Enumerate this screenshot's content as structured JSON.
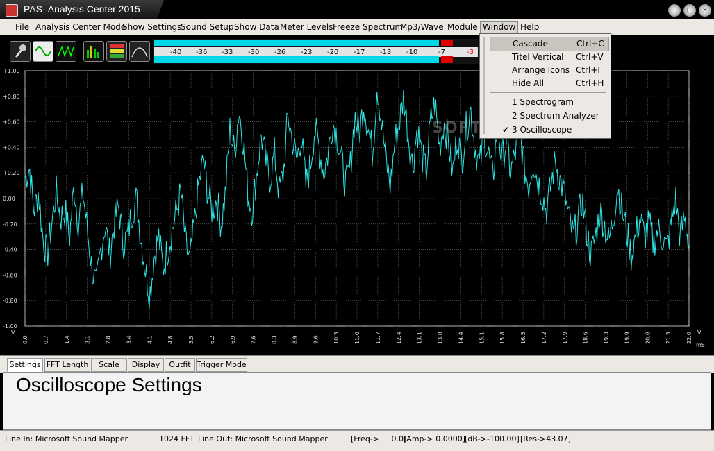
{
  "window": {
    "title": "PAS- Analysis Center 2015"
  },
  "menu": [
    "File",
    "Analysis Center Mode",
    "Show Settings",
    "Sound Setup",
    "Show Data",
    "Meter Levels",
    "Freeze Spectrum",
    "Mp3/Wave",
    "Module",
    "Window",
    "Help"
  ],
  "meter": {
    "scale": [
      "-40",
      "-36",
      "-33",
      "-30",
      "-26",
      "-23",
      "-20",
      "-17",
      "-13",
      "-10",
      "-7",
      "-3"
    ],
    "level_top": 0.88,
    "level_bottom": 0.88
  },
  "window_menu": {
    "items": [
      {
        "label": "Cascade",
        "shortcut": "Ctrl+C"
      },
      {
        "label": "Titel Vertical",
        "shortcut": "Ctrl+V"
      },
      {
        "label": "Arrange Icons",
        "shortcut": "Ctrl+I"
      },
      {
        "label": "Hide All",
        "shortcut": "Ctrl+H"
      }
    ],
    "windows": [
      "1 Spectrogram",
      "2 Spectrum Analyzer",
      "3 Oscilloscope"
    ]
  },
  "chart_data": {
    "type": "line",
    "ylim": [
      -1.0,
      1.0
    ],
    "y_ticks": [
      "+1.00",
      "+0.80",
      "+0.60",
      "+0.40",
      "+0.20",
      "0.00",
      "-0.20",
      "-0.40",
      "-0.60",
      "-0.80",
      "-1.00"
    ],
    "x_ticks": [
      "0.0",
      "0.7",
      "1.4",
      "2.1",
      "2.8",
      "3.4",
      "4.1",
      "4.8",
      "5.5",
      "6.2",
      "6.9",
      "7.6",
      "8.3",
      "8.9",
      "9.6",
      "10.3",
      "11.0",
      "11.7",
      "12.4",
      "13.1",
      "13.8",
      "14.4",
      "15.1",
      "15.8",
      "16.5",
      "17.2",
      "17.9",
      "18.6",
      "19.3",
      "19.9",
      "20.6",
      "21.3",
      "22.0"
    ],
    "y_unit": "V",
    "x_unit": "mS",
    "color": "#2ee6e6",
    "waveform": [
      0.15,
      0.25,
      -0.1,
      0.05,
      -0.3,
      -0.45,
      -0.2,
      0.05,
      -0.15,
      -0.1,
      -0.3,
      0.1,
      -0.2,
      0.05,
      -0.25,
      -0.55,
      -0.7,
      -0.4,
      -0.2,
      -0.45,
      -0.2,
      -0.05,
      -0.35,
      -0.3,
      -0.1,
      0.0,
      -0.3,
      -0.55,
      -0.75,
      -0.45,
      -0.3,
      -0.55,
      -0.4,
      -0.25,
      -0.1,
      0.05,
      -0.35,
      -0.5,
      -0.2,
      0.1,
      0.3,
      0.05,
      -0.1,
      0.0,
      -0.2,
      0.05,
      0.55,
      0.35,
      0.7,
      0.45,
      0.05,
      -0.1,
      0.2,
      0.5,
      0.3,
      0.15,
      0.35,
      0.05,
      0.2,
      0.65,
      0.45,
      0.3,
      0.5,
      0.1,
      0.25,
      0.55,
      0.4,
      0.2,
      0.35,
      0.6,
      0.5,
      0.3,
      0.1,
      0.25,
      0.65,
      0.5,
      0.75,
      0.55,
      0.35,
      0.9,
      0.6,
      0.3,
      0.1,
      0.45,
      0.6,
      0.8,
      0.5,
      0.25,
      0.55,
      0.35,
      0.2,
      0.6,
      0.75,
      0.4,
      0.6,
      0.45,
      0.2,
      0.5,
      0.3,
      0.55,
      0.7,
      0.4,
      0.25,
      0.5,
      0.35,
      0.15,
      0.6,
      0.3,
      0.45,
      0.2,
      0.35,
      0.55,
      0.25,
      0.1,
      0.3,
      0.15,
      0.05,
      -0.1,
      0.1,
      0.3,
      0.15,
      0.05,
      -0.15,
      -0.3,
      -0.2,
      0.0,
      -0.25,
      -0.45,
      -0.3,
      -0.1,
      -0.2,
      -0.35,
      -0.15,
      0.1,
      -0.1,
      -0.25,
      -0.45,
      -0.3,
      -0.15,
      -0.3,
      -0.2,
      -0.35,
      -0.25,
      -0.3,
      -0.4,
      -0.2,
      0.0,
      -0.3,
      -0.15,
      -0.35
    ]
  },
  "bottom_tabs": [
    "Settings",
    "FFT Length",
    "Scale",
    "Display",
    "Outfit",
    "Trigger Mode"
  ],
  "panel": {
    "title": "Oscilloscope Settings"
  },
  "status": {
    "line_in": "Line In: Microsoft Sound Mapper",
    "fft": "1024 FFT",
    "line_out": "Line Out: Microsoft Sound Mapper",
    "freq": "[Freq->     0.0]",
    "amp": "[Amp-> 0.0000]",
    "db": "[dB->-100.00]",
    "res": "[Res->43.07]"
  },
  "watermark": "SOFTPEDIA"
}
